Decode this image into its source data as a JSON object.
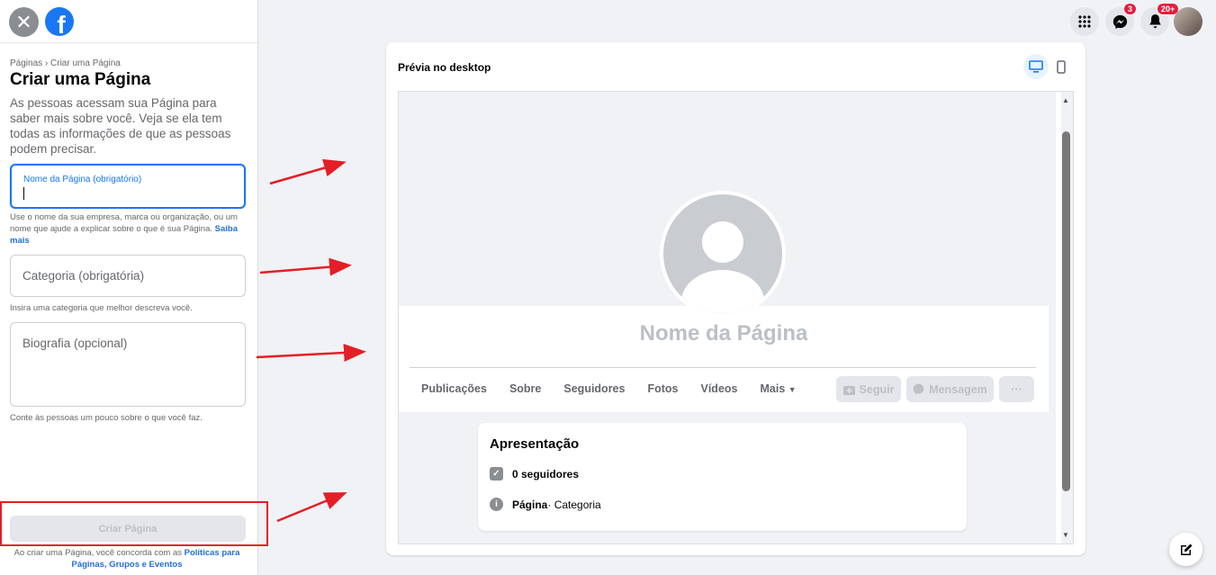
{
  "left_panel": {
    "breadcrumb": "Páginas › Criar uma Página",
    "title": "Criar uma Página",
    "description": "As pessoas acessam sua Página para saber mais sobre você. Veja se ela tem todas as informações de que as pessoas podem precisar.",
    "name_field": {
      "label": "Nome da Página (obrigatório)",
      "value": ""
    },
    "name_hint": "Use o nome da sua empresa, marca ou organização, ou um nome que ajude a explicar sobre o que é sua Página.",
    "name_hint_link": "Saiba mais",
    "category_field": {
      "placeholder": "Categoria (obrigatória)"
    },
    "category_hint": "Insira uma categoria que melhor descreva você.",
    "bio_field": {
      "placeholder": "Biografia (opcional)"
    },
    "bio_hint": "Conte às pessoas um pouco sobre o que você faz.",
    "create_button": "Criar Página",
    "terms_text": "Ao criar uma Página, você concorda com as",
    "terms_link": "Políticas para Páginas, Grupos e Eventos"
  },
  "top_bar": {
    "messenger_badge": "3",
    "notifications_badge": "20+"
  },
  "preview": {
    "title": "Prévia no desktop",
    "page_name": "Nome da Página",
    "tabs": [
      "Publicações",
      "Sobre",
      "Seguidores",
      "Fotos",
      "Vídeos",
      "Mais"
    ],
    "follow_button": "Seguir",
    "message_button": "Mensagem",
    "more_button": "···",
    "intro": {
      "title": "Apresentação",
      "followers": "0 seguidores",
      "page_label": "Página",
      "category_label": " · Categoria"
    }
  },
  "colors": {
    "accent": "#1877f2",
    "annotation_red": "#e41e26"
  }
}
